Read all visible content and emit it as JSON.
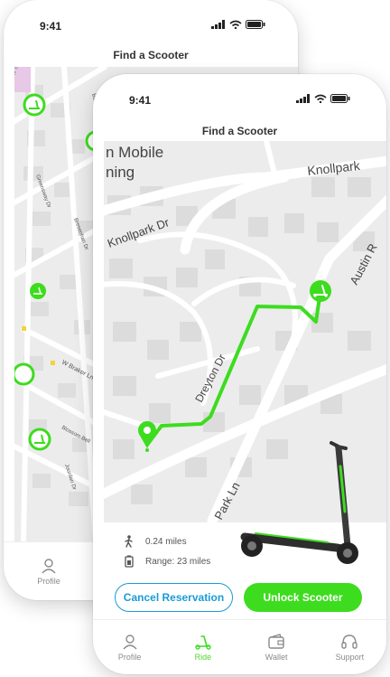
{
  "back_phone": {
    "status_time": "9:41",
    "title": "Find a Scooter",
    "streets": [
      "Barcelleta Dr",
      "Greensway Dr",
      "Bresenhan Dr",
      "W Braker Ln",
      "Blossom Bell",
      "Jourdan Dr"
    ],
    "tab_profile": "Profile"
  },
  "front_phone": {
    "status_time": "9:41",
    "title": "Find a Scooter",
    "map_labels": {
      "poi_line1": "n Mobile",
      "poi_line2": "ning",
      "knollpark_top": "Knollpark",
      "knollpark_left": "Knollpark Dr",
      "dreyton": "Dreyton Dr",
      "austin": "Austin R",
      "park_ln": "Park Ln"
    },
    "info": {
      "distance": "0.24 miles",
      "range": "Range: 23 miles"
    },
    "buttons": {
      "cancel": "Cancel Reservation",
      "unlock": "Unlock Scooter"
    },
    "tabs": [
      "Profile",
      "Ride",
      "Wallet",
      "Support"
    ],
    "active_tab": "Ride"
  },
  "colors": {
    "accent_green": "#3ddc1f",
    "accent_blue": "#1a9bd7"
  }
}
